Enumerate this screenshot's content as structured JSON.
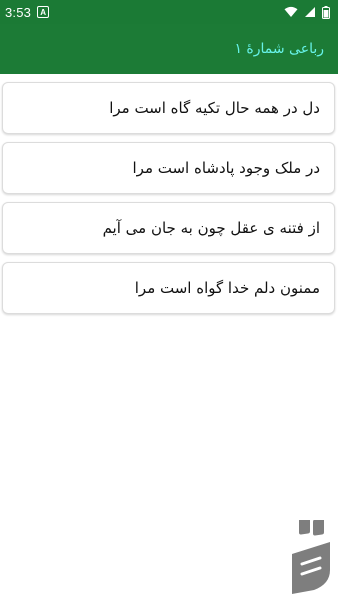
{
  "status_bar": {
    "time": "3:53",
    "notification_icon_letter": "A",
    "icons": [
      "notification-a-icon",
      "wifi-icon",
      "signal-icon",
      "battery-icon"
    ]
  },
  "app_bar": {
    "title": "رباعی شمارهٔ ۱",
    "title_color": "#67f2e8",
    "background_color": "#1c7b36"
  },
  "verses": [
    "دل در همه حال تکیه گاه است مرا",
    "در ملک وجود پادشاه است مرا",
    "از فتنه ی عقل چون به جان می آیم",
    "ممنون دلم خدا گواه است مرا"
  ],
  "watermark": {
    "icon": "bazaar-logo-icon",
    "color": "#7e7e7e"
  }
}
